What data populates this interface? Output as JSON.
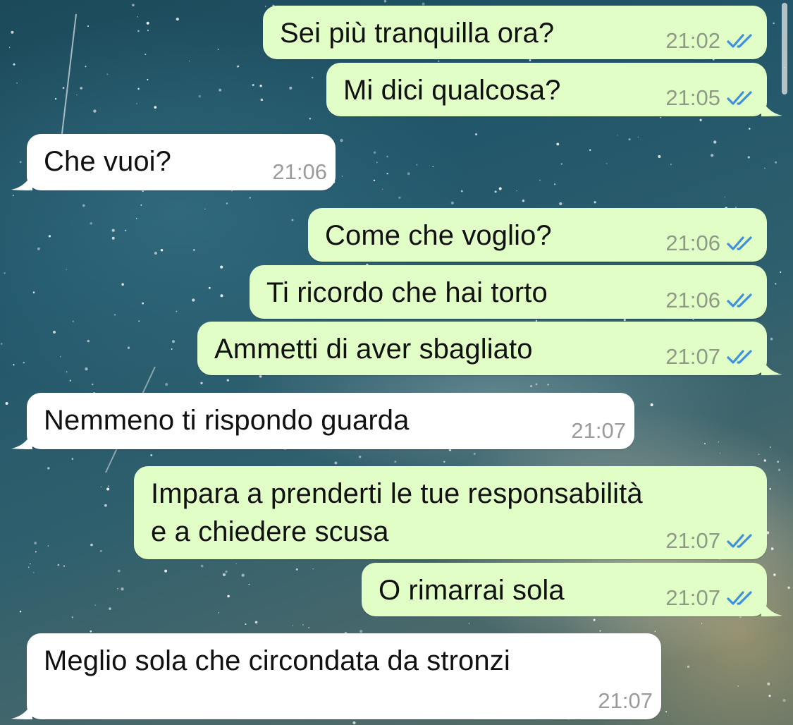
{
  "chat": {
    "messages": [
      {
        "direction": "outgoing",
        "text": "Sei più tranquilla ora?",
        "time": "21:02",
        "status": "read"
      },
      {
        "direction": "outgoing",
        "text": "Mi dici qualcosa?",
        "time": "21:05",
        "status": "read"
      },
      {
        "direction": "incoming",
        "text": "Che vuoi?",
        "time": "21:06"
      },
      {
        "direction": "outgoing",
        "text": "Come che voglio?",
        "time": "21:06",
        "status": "read"
      },
      {
        "direction": "outgoing",
        "text": "Ti ricordo che hai torto",
        "time": "21:06",
        "status": "read"
      },
      {
        "direction": "outgoing",
        "text": "Ammetti di aver sbagliato",
        "time": "21:07",
        "status": "read"
      },
      {
        "direction": "incoming",
        "text": "Nemmeno ti rispondo guarda",
        "time": "21:07"
      },
      {
        "direction": "outgoing",
        "text": "Impara a prenderti le tue responsabilità\ne a chiedere scusa",
        "time": "21:07",
        "status": "read"
      },
      {
        "direction": "outgoing",
        "text": "O rimarrai sola",
        "time": "21:07",
        "status": "read"
      },
      {
        "direction": "incoming",
        "text": "Meglio sola che circondata da stronzi",
        "time": "21:07"
      }
    ]
  },
  "icons": {
    "read_receipt": "double-check-icon"
  },
  "colors": {
    "outgoing_bubble": "#e1fec6",
    "incoming_bubble": "#ffffff",
    "read_check": "#3d8fe0",
    "outgoing_time": "#8e9a85",
    "incoming_time": "#9b9b9b"
  }
}
